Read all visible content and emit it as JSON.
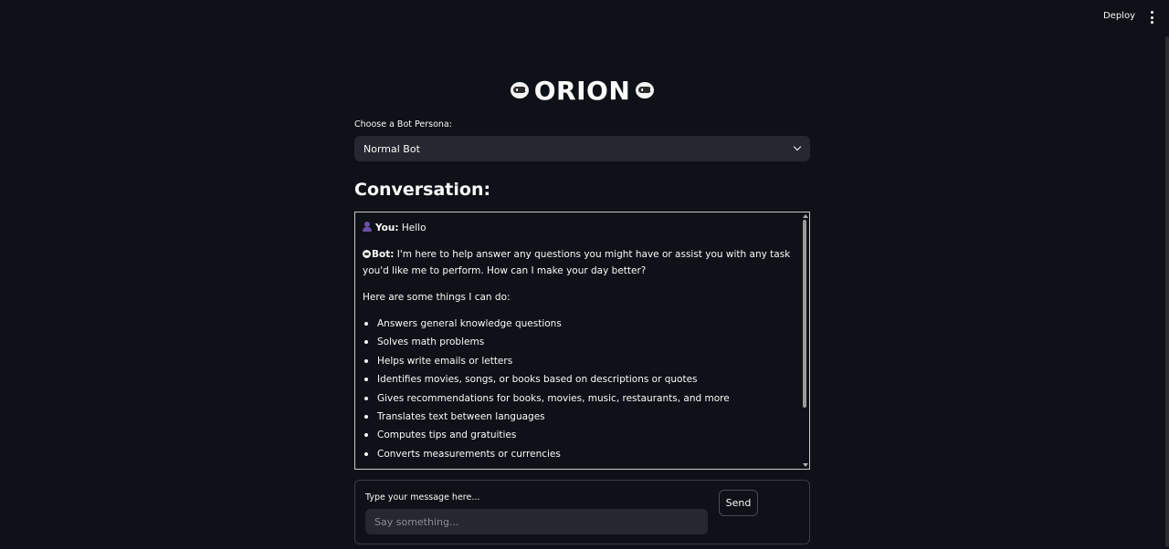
{
  "header": {
    "deploy_label": "Deploy",
    "menu_icon": "vertical-ellipsis-icon"
  },
  "title": {
    "text": "ORION",
    "icon": "robot-face-icon"
  },
  "persona_select": {
    "label": "Choose a Bot Persona:",
    "value": "Normal Bot"
  },
  "conversation": {
    "heading": "Conversation:",
    "user_label": "You:",
    "user_message": "Hello",
    "bot_label": "Bot:",
    "bot_intro": "I'm here to help answer any questions you might have or assist you with any task you'd like me to perform. How can I make your day better?",
    "list_intro": "Here are some things I can do:",
    "capabilities": [
      "Answers general knowledge questions",
      "Solves math problems",
      "Helps write emails or letters",
      "Identifies movies, songs, or books based on descriptions or quotes",
      "Gives recommendations for books, movies, music, restaurants, and more",
      "Translates text between languages",
      "Computes tips and gratuities",
      "Converts measurements or currencies"
    ]
  },
  "message_form": {
    "label": "Type your message here...",
    "placeholder": "Say something...",
    "send_label": "Send"
  },
  "colors": {
    "background": "#0e1117",
    "input_background": "#262730",
    "text": "#fafafa"
  }
}
